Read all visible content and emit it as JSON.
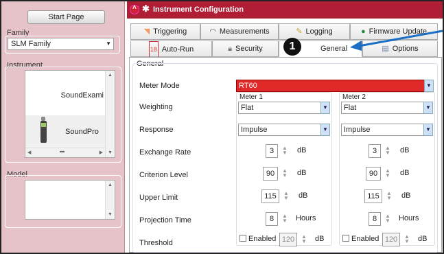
{
  "left": {
    "start_page": "Start Page",
    "family_label": "Family",
    "family_value": "SLM Family",
    "instrument_label": "Instrument",
    "instruments": [
      "SoundExami",
      "SoundPro"
    ],
    "model_label": "Model"
  },
  "window": {
    "title": "Instrument Configuration"
  },
  "tabs_row1": [
    {
      "label": "Triggering",
      "icon": "trigger-icon"
    },
    {
      "label": "Measurements",
      "icon": "gauge-icon"
    },
    {
      "label": "Logging",
      "icon": "pencil-icon"
    },
    {
      "label": "Firmware Update",
      "icon": "globe-icon"
    }
  ],
  "tabs_row2": [
    {
      "label": "Auto-Run",
      "icon": "autorun-icon"
    },
    {
      "label": "Security",
      "icon": "lock-icon"
    },
    {
      "label": "General",
      "icon": "general-icon"
    },
    {
      "label": "Options",
      "icon": "options-icon"
    }
  ],
  "callout": "1",
  "general": {
    "group_label": "General",
    "meter_mode_label": "Meter Mode",
    "meter_mode_value": "RT60",
    "labels": {
      "weighting": "Weighting",
      "response": "Response",
      "exchange_rate": "Exchange Rate",
      "criterion_level": "Criterion Level",
      "upper_limit": "Upper Limit",
      "projection_time": "Projection Time",
      "threshold": "Threshold"
    },
    "meters": [
      {
        "title": "Meter 1",
        "weighting": "Flat",
        "response": "Impulse",
        "exchange_rate": "3",
        "criterion_level": "90",
        "upper_limit": "115",
        "projection_time": "8",
        "threshold_enabled": "Enabled",
        "threshold": "120"
      },
      {
        "title": "Meter 2",
        "weighting": "Flat",
        "response": "Impulse",
        "exchange_rate": "3",
        "criterion_level": "90",
        "upper_limit": "115",
        "projection_time": "8",
        "threshold_enabled": "Enabled",
        "threshold": "120"
      }
    ],
    "units": {
      "db": "dB",
      "hours": "Hours"
    }
  },
  "colors": {
    "title_bar": "#b01e35",
    "meter_mode_bg": "#e02929",
    "sidebar_bg": "#e6c3c9",
    "arrow": "#1a6fc4"
  }
}
